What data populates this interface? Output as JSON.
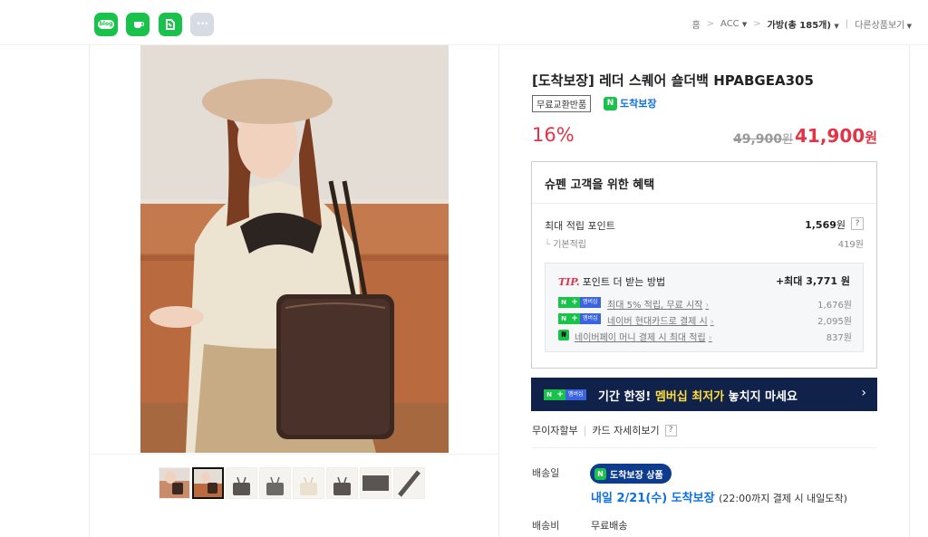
{
  "header": {
    "sns": [
      {
        "name": "blog",
        "label": "blog"
      },
      {
        "name": "cafe",
        "label": ""
      },
      {
        "name": "band",
        "label": ""
      },
      {
        "name": "more",
        "label": "•••"
      }
    ],
    "breadcrumb": {
      "home": "홈",
      "acc": "ACC",
      "bag": "가방(총 185개)",
      "other": "다른상품보기"
    }
  },
  "gallery": {
    "thumbnail_count": 8,
    "selected_index": 1
  },
  "product": {
    "title": "[도착보장] 레더 스퀘어 숄더백 HPABGEA305",
    "badge_free": "무료교환반품",
    "arrival_badge": "도착보장",
    "discount": "16%",
    "original_price": "49,900",
    "original_unit": "원",
    "sale_price": "41,900",
    "sale_unit": "원"
  },
  "benefit": {
    "title": "슈펜 고객을 위한 혜택",
    "max_points_label": "최대 적립 포인트",
    "max_points_value": "1,569",
    "max_points_unit": "원",
    "help": "?",
    "basic_label": "기본적립",
    "basic_value": "419원",
    "tip": {
      "tip_word": "TIP.",
      "title": "포인트 더 받는 방법",
      "max": "+최대 3,771 원",
      "rows": [
        {
          "badge": "멤버십",
          "text": "최대 5% 적립, 무료 시작",
          "amount": "1,676원"
        },
        {
          "badge": "멤버십",
          "text": "네이버 현대카드로 결제 시",
          "amount": "2,095원"
        },
        {
          "badge": "",
          "text": "네이버페이 머니 결제 시 최대 적립",
          "amount": "837원"
        }
      ]
    }
  },
  "banner": {
    "badge": "멤버십",
    "text_prefix": "기간 한정! ",
    "text_highlight": "멤버십 최저가",
    "text_suffix": " 놓치지 마세요",
    "arrow": "›"
  },
  "payment": {
    "installment": "무이자할부",
    "card_detail": "카드 자세히보기",
    "help": "?"
  },
  "shipping": {
    "label": "배송일",
    "pill": "도착보장 상품",
    "date": "내일 2/21(수) 도착보장",
    "note": "(22:00까지 결제 시 내일도착)",
    "fee_label": "배송비",
    "fee_value": "무료배송"
  },
  "colors": {
    "sale_red": "#e23347",
    "naver_green": "#19c24a",
    "arrival_blue": "#0d70e8",
    "banner_navy": "#10214a",
    "banner_highlight": "#ffdf3b"
  }
}
